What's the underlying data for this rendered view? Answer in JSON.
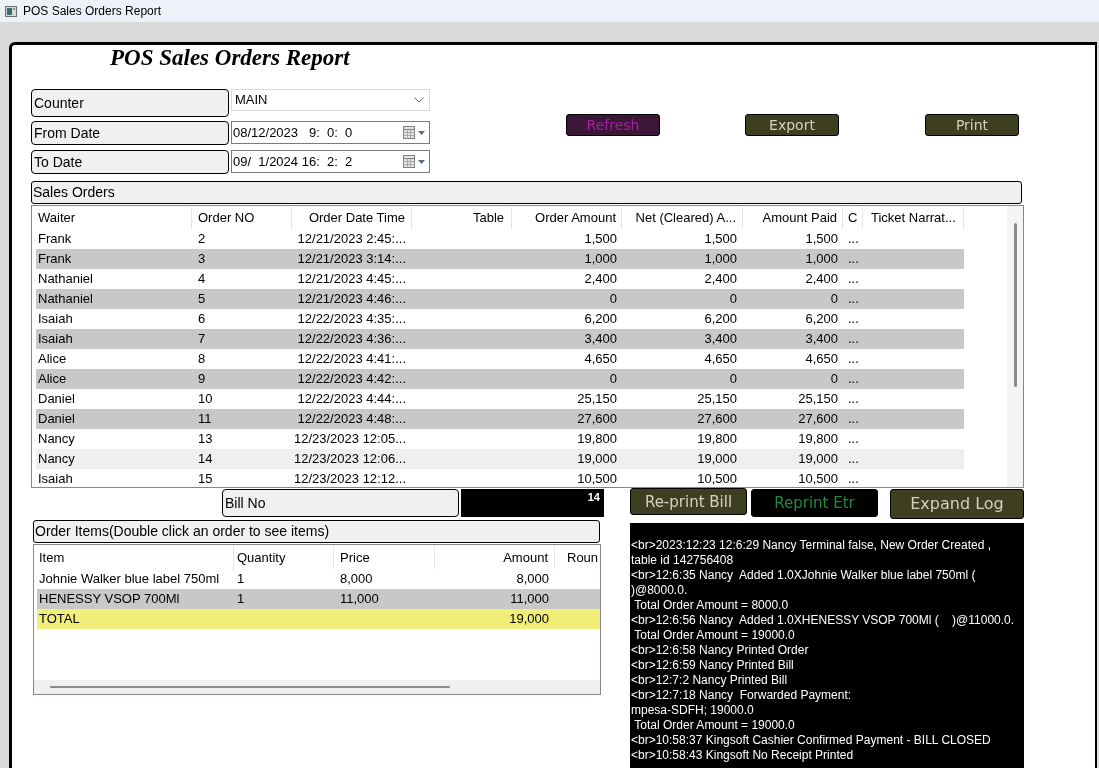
{
  "window": {
    "title": "POS Sales Orders Report"
  },
  "report_title": "POS Sales Orders Report",
  "filters": [
    {
      "kind": "dropdown",
      "label": "Counter",
      "value": "MAIN"
    },
    {
      "kind": "date",
      "label": "From Date",
      "value": "08/12/2023   9:  0:  0"
    },
    {
      "kind": "date",
      "label": "To Date",
      "value": "09/  1/2024 16:  2:  2"
    }
  ],
  "actions": [
    {
      "kind": "accent",
      "label": "Refresh"
    },
    {
      "kind": "normal",
      "label": "Export"
    },
    {
      "kind": "normal",
      "label": "Print"
    }
  ],
  "sales_orders": {
    "title": "Sales Orders",
    "columns": [
      "Waiter",
      "Order NO",
      "Order Date Time",
      "Table",
      "Order Amount",
      "Net (Cleared) A...",
      "Amount Paid",
      "C",
      "Ticket Narrat..."
    ],
    "rows": [
      {
        "waiter": "Frank",
        "order_no": "2",
        "order_date_time": "12/21/2023 2:45:...",
        "order_amount": "1,500",
        "net_cleared": "1,500",
        "amount_paid": "1,500",
        "c": "...",
        "selected": false
      },
      {
        "waiter": "Frank",
        "order_no": "3",
        "order_date_time": "12/21/2023 3:14:...",
        "order_amount": "1,000",
        "net_cleared": "1,000",
        "amount_paid": "1,000",
        "c": "...",
        "selected": false
      },
      {
        "waiter": "Nathaniel",
        "order_no": "4",
        "order_date_time": "12/21/2023 4:45:...",
        "order_amount": "2,400",
        "net_cleared": "2,400",
        "amount_paid": "2,400",
        "c": "...",
        "selected": false
      },
      {
        "waiter": "Nathaniel",
        "order_no": "5",
        "order_date_time": "12/21/2023 4:46:...",
        "order_amount": "0",
        "net_cleared": "0",
        "amount_paid": "0",
        "c": "...",
        "selected": false
      },
      {
        "waiter": "Isaiah",
        "order_no": "6",
        "order_date_time": "12/22/2023 4:35:...",
        "order_amount": "6,200",
        "net_cleared": "6,200",
        "amount_paid": "6,200",
        "c": "...",
        "selected": false
      },
      {
        "waiter": "Isaiah",
        "order_no": "7",
        "order_date_time": "12/22/2023 4:36:...",
        "order_amount": "3,400",
        "net_cleared": "3,400",
        "amount_paid": "3,400",
        "c": "...",
        "selected": false
      },
      {
        "waiter": "Alice",
        "order_no": "8",
        "order_date_time": "12/22/2023 4:41:...",
        "order_amount": "4,650",
        "net_cleared": "4,650",
        "amount_paid": "4,650",
        "c": "...",
        "selected": false
      },
      {
        "waiter": "Alice",
        "order_no": "9",
        "order_date_time": "12/22/2023 4:42:...",
        "order_amount": "0",
        "net_cleared": "0",
        "amount_paid": "0",
        "c": "...",
        "selected": false
      },
      {
        "waiter": "Daniel",
        "order_no": "10",
        "order_date_time": "12/22/2023 4:44:...",
        "order_amount": "25,150",
        "net_cleared": "25,150",
        "amount_paid": "25,150",
        "c": "...",
        "selected": false
      },
      {
        "waiter": "Daniel",
        "order_no": "11",
        "order_date_time": "12/22/2023 4:48:...",
        "order_amount": "27,600",
        "net_cleared": "27,600",
        "amount_paid": "27,600",
        "c": "...",
        "selected": false
      },
      {
        "waiter": "Nancy",
        "order_no": "13",
        "order_date_time": "12/23/2023 12:05...",
        "order_amount": "19,800",
        "net_cleared": "19,800",
        "amount_paid": "19,800",
        "c": "...",
        "selected": false
      },
      {
        "waiter": "Nancy",
        "order_no": "14",
        "order_date_time": "12/23/2023 12:06...",
        "order_amount": "19,000",
        "net_cleared": "19,000",
        "amount_paid": "19,000",
        "c": "...",
        "selected": true
      },
      {
        "waiter": "Isaiah",
        "order_no": "15",
        "order_date_time": "12/23/2023 12:12...",
        "order_amount": "10,500",
        "net_cleared": "10,500",
        "amount_paid": "10,500",
        "c": "...",
        "selected": false
      }
    ]
  },
  "bill_no": {
    "label": "Bill No",
    "value": "14"
  },
  "order_items": {
    "title": "Order Items(Double click an order to see items)",
    "columns": [
      "Item",
      "Quantity",
      "Price",
      "Amount",
      "Roun"
    ],
    "rows": [
      {
        "kind": "item",
        "item": "Johnie Walker blue label 750ml",
        "quantity": "1",
        "price": "8,000",
        "amount": "8,000"
      },
      {
        "kind": "item",
        "item": "HENESSY VSOP 700Ml",
        "quantity": "1",
        "price": "11,000",
        "amount": "11,000"
      },
      {
        "kind": "total",
        "item": "TOTAL",
        "amount": "19,000"
      }
    ]
  },
  "log_buttons": [
    {
      "kind": "normal",
      "label": "Re-print Bill"
    },
    {
      "kind": "dark",
      "label": "Reprint Etr"
    },
    {
      "kind": "normal",
      "label": "Expand Log"
    }
  ],
  "log": [
    "<br>2023:12:23 12:6:29 Nancy Terminal false, New Order Created , table id 142756408",
    "<br>12:6:35 Nancy  Added 1.0XJohnie Walker blue label 750ml (    )@8000.0.",
    " Total Order Amount = 8000.0",
    "<br>12:6:56 Nancy  Added 1.0XHENESSY VSOP 700Ml (    )@11000.0.",
    " Total Order Amount = 19000.0",
    "<br>12:6:58 Nancy Printed Order",
    "<br>12:6:59 Nancy Printed Bill",
    "<br>12:7:2 Nancy Printed Bill",
    "<br>12:7:18 Nancy  Forwarded Payment:",
    "mpesa-SDFH; 19000.0",
    " Total Order Amount = 19000.0",
    "<br>10:58:37 Kingsoft Cashier Confirmed Payment - BILL CLOSED",
    "<br>10:58:43 Kingsoft No Receipt Printed"
  ]
}
